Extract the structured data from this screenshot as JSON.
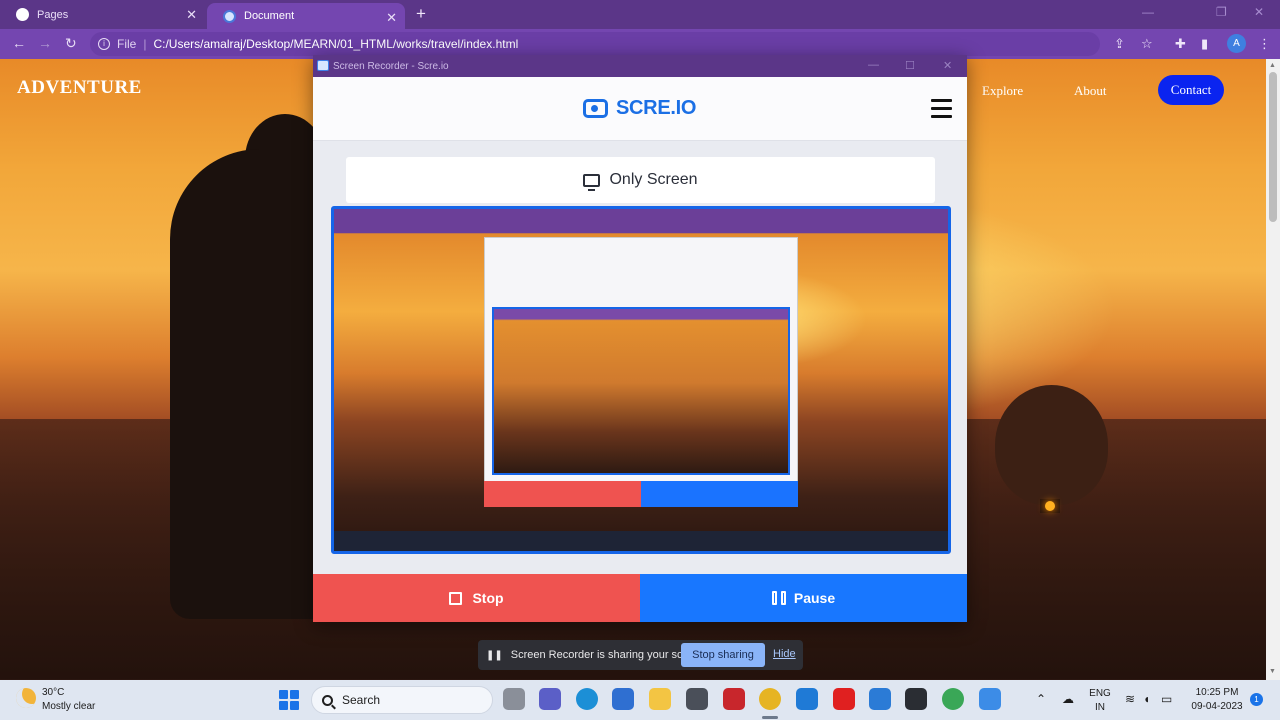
{
  "browser": {
    "tabs": [
      {
        "label": "Pages",
        "icon": "github-icon"
      },
      {
        "label": "Document",
        "icon": "recorder-icon",
        "active": true
      }
    ],
    "new_tab": "+",
    "close": "✕",
    "address": {
      "scheme_label": "File",
      "url": "C:/Users/amalraj/Desktop/MEARN/01_HTML/works/travel/index.html"
    },
    "profile_initial": "A"
  },
  "site": {
    "brand": "ADVENTURE",
    "nav": [
      "Explore",
      "About"
    ],
    "contact": "Contact"
  },
  "recorder": {
    "window_title": "Screen Recorder - Scre.io",
    "logo": "SCRE.IO",
    "mode": "Only Screen",
    "stop": "Stop",
    "pause": "Pause",
    "colors": {
      "stop": "#ef5350",
      "pause": "#1877ff",
      "accent": "#1b6fe5"
    }
  },
  "share_bar": {
    "message": "Screen Recorder is sharing your screen.",
    "stop_sharing": "Stop sharing",
    "hide": "Hide"
  },
  "taskbar": {
    "weather": {
      "temp": "30°C",
      "desc": "Mostly clear"
    },
    "search": "Search",
    "lang": {
      "line1": "ENG",
      "line2": "IN"
    },
    "time": "10:25 PM",
    "date": "09-04-2023",
    "notif_count": "1"
  }
}
